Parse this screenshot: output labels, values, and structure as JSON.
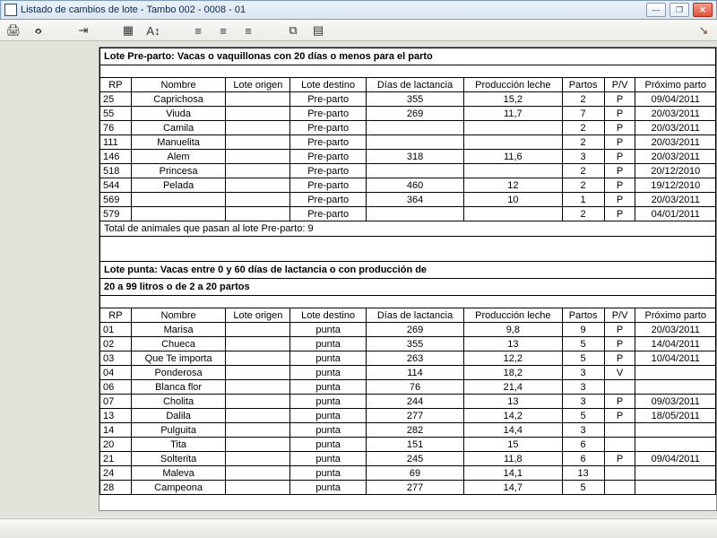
{
  "window": {
    "title": "Listado de cambios de lote - Tambo 002 - 0008 - 01"
  },
  "columns": {
    "rp": "RP",
    "nombre": "Nombre",
    "lote_origen": "Lote origen",
    "lote_destino": "Lote destino",
    "dias_lact": "Días de lactancia",
    "prod_leche": "Producción leche",
    "partos": "Partos",
    "pv": "P/V",
    "prox_parto": "Próximo parto"
  },
  "sections": [
    {
      "title": "Lote Pre-parto: Vacas o vaquillonas con 20 días o menos para el parto",
      "rows": [
        {
          "rp": "25",
          "nombre": "Caprichosa",
          "lo": "",
          "ld": "Pre-parto",
          "dl": "355",
          "pl": "15,2",
          "pa": "2",
          "pv": "P",
          "px": "09/04/2011"
        },
        {
          "rp": "55",
          "nombre": "Viuda",
          "lo": "",
          "ld": "Pre-parto",
          "dl": "269",
          "pl": "11,7",
          "pa": "7",
          "pv": "P",
          "px": "20/03/2011"
        },
        {
          "rp": "76",
          "nombre": "Camila",
          "lo": "",
          "ld": "Pre-parto",
          "dl": "",
          "pl": "",
          "pa": "2",
          "pv": "P",
          "px": "20/03/2011"
        },
        {
          "rp": "111",
          "nombre": "Manuelita",
          "lo": "",
          "ld": "Pre-parto",
          "dl": "",
          "pl": "",
          "pa": "2",
          "pv": "P",
          "px": "20/03/2011"
        },
        {
          "rp": "146",
          "nombre": "Alem",
          "lo": "",
          "ld": "Pre-parto",
          "dl": "318",
          "pl": "11,6",
          "pa": "3",
          "pv": "P",
          "px": "20/03/2011"
        },
        {
          "rp": "518",
          "nombre": "Princesa",
          "lo": "",
          "ld": "Pre-parto",
          "dl": "",
          "pl": "",
          "pa": "2",
          "pv": "P",
          "px": "20/12/2010"
        },
        {
          "rp": "544",
          "nombre": "Pelada",
          "lo": "",
          "ld": "Pre-parto",
          "dl": "460",
          "pl": "12",
          "pa": "2",
          "pv": "P",
          "px": "19/12/2010"
        },
        {
          "rp": "569",
          "nombre": "",
          "lo": "",
          "ld": "Pre-parto",
          "dl": "364",
          "pl": "10",
          "pa": "1",
          "pv": "P",
          "px": "20/03/2011"
        },
        {
          "rp": "579",
          "nombre": "",
          "lo": "",
          "ld": "Pre-parto",
          "dl": "",
          "pl": "",
          "pa": "2",
          "pv": "P",
          "px": "04/01/2011"
        }
      ],
      "total_text": "Total de animales que pasan al lote Pre-parto: 9"
    },
    {
      "title": "Lote punta: Vacas entre 0 y 60 días de lactancia o con producción de",
      "title2": "20 a 99 litros o de 2 a 20 partos",
      "rows": [
        {
          "rp": "01",
          "nombre": "Marisa",
          "lo": "",
          "ld": "punta",
          "dl": "269",
          "pl": "9,8",
          "pa": "9",
          "pv": "P",
          "px": "20/03/2011"
        },
        {
          "rp": "02",
          "nombre": "Chueca",
          "lo": "",
          "ld": "punta",
          "dl": "355",
          "pl": "13",
          "pa": "5",
          "pv": "P",
          "px": "14/04/2011"
        },
        {
          "rp": "03",
          "nombre": "Que Te importa",
          "lo": "",
          "ld": "punta",
          "dl": "263",
          "pl": "12,2",
          "pa": "5",
          "pv": "P",
          "px": "10/04/2011"
        },
        {
          "rp": "04",
          "nombre": "Ponderosa",
          "lo": "",
          "ld": "punta",
          "dl": "114",
          "pl": "18,2",
          "pa": "3",
          "pv": "V",
          "px": ""
        },
        {
          "rp": "06",
          "nombre": "Blanca flor",
          "lo": "",
          "ld": "punta",
          "dl": "76",
          "pl": "21,4",
          "pa": "3",
          "pv": "",
          "px": ""
        },
        {
          "rp": "07",
          "nombre": "Cholita",
          "lo": "",
          "ld": "punta",
          "dl": "244",
          "pl": "13",
          "pa": "3",
          "pv": "P",
          "px": "09/03/2011"
        },
        {
          "rp": "13",
          "nombre": "Dalila",
          "lo": "",
          "ld": "punta",
          "dl": "277",
          "pl": "14,2",
          "pa": "5",
          "pv": "P",
          "px": "18/05/2011"
        },
        {
          "rp": "14",
          "nombre": "Pulguita",
          "lo": "",
          "ld": "punta",
          "dl": "282",
          "pl": "14,4",
          "pa": "3",
          "pv": "",
          "px": ""
        },
        {
          "rp": "20",
          "nombre": "Tita",
          "lo": "",
          "ld": "punta",
          "dl": "151",
          "pl": "15",
          "pa": "6",
          "pv": "",
          "px": ""
        },
        {
          "rp": "21",
          "nombre": "Solterita",
          "lo": "",
          "ld": "punta",
          "dl": "245",
          "pl": "11,8",
          "pa": "6",
          "pv": "P",
          "px": "09/04/2011"
        },
        {
          "rp": "24",
          "nombre": "Maleva",
          "lo": "",
          "ld": "punta",
          "dl": "69",
          "pl": "14,1",
          "pa": "13",
          "pv": "",
          "px": ""
        },
        {
          "rp": "28",
          "nombre": "Campeona",
          "lo": "",
          "ld": "punta",
          "dl": "277",
          "pl": "14,7",
          "pa": "5",
          "pv": "",
          "px": ""
        }
      ]
    }
  ]
}
